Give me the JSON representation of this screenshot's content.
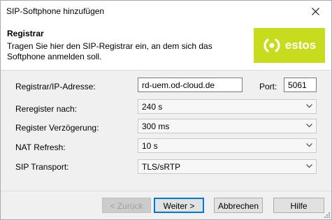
{
  "window": {
    "title": "SIP-Softphone hinzufügen"
  },
  "header": {
    "title": "Registrar",
    "description": "Tragen Sie hier den SIP-Registrar ein, an dem sich das Softphone anmelden soll.",
    "logo_text": "estos",
    "logo_color": "#c8dc1e"
  },
  "form": {
    "registrar": {
      "label": "Registrar/IP-Adresse:",
      "value": "rd-uem.od-cloud.de"
    },
    "port": {
      "label": "Port:",
      "value": "5061"
    },
    "reregister": {
      "label": "Reregister nach:",
      "value": "240 s"
    },
    "register_delay": {
      "label": "Register Verzögerung:",
      "value": "300 ms"
    },
    "nat_refresh": {
      "label": "NAT Refresh:",
      "value": "10 s"
    },
    "sip_transport": {
      "label": "SIP Transport:",
      "value": "TLS/sRTP"
    }
  },
  "buttons": {
    "back": "< Zurück",
    "next": "Weiter >",
    "cancel": "Abbrechen",
    "help": "Hilfe"
  },
  "icons": {
    "close": "close-icon",
    "dropdown": "chevron-down-icon",
    "logo": "estos-logo-icon",
    "resize": "resize-grip-icon"
  }
}
